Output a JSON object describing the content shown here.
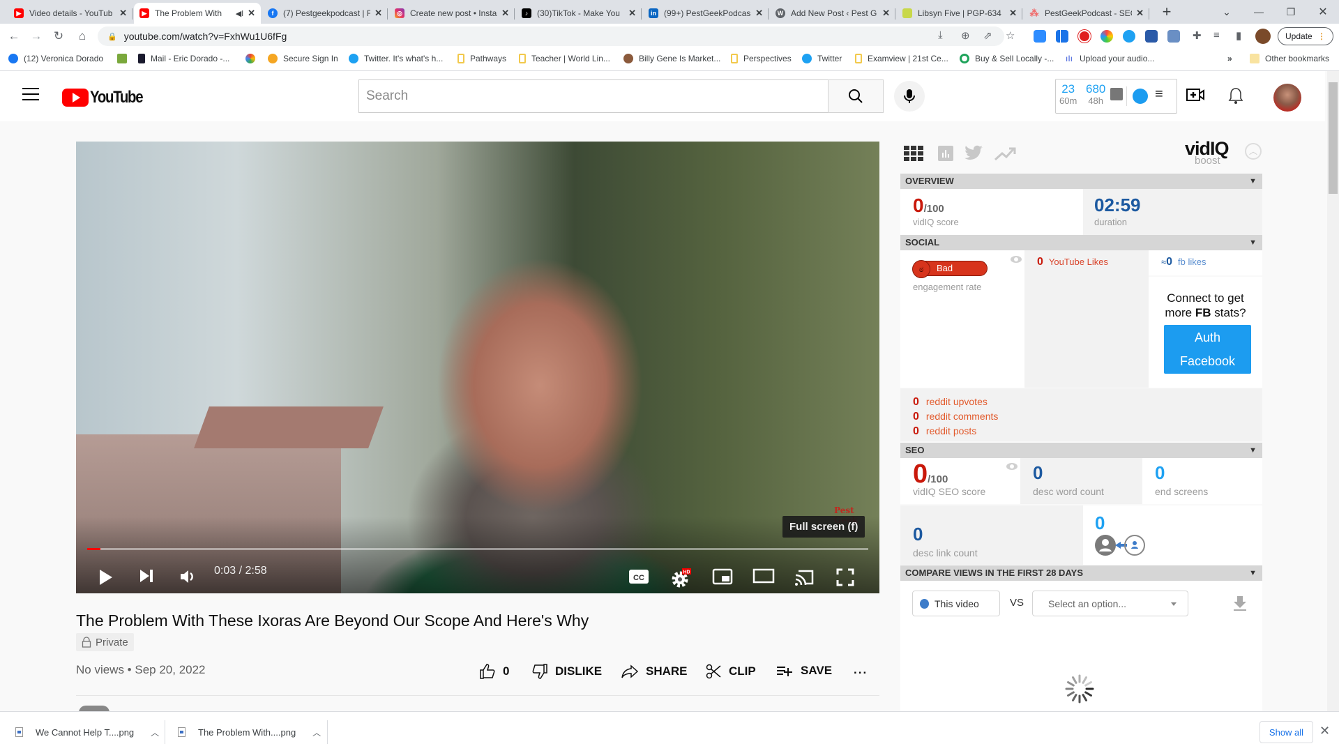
{
  "browser": {
    "tabs": [
      {
        "label": "Video details - YouTub",
        "icon": "youtube-icon",
        "color": "#ff0000",
        "active": false
      },
      {
        "label": "The Problem With",
        "icon": "youtube-icon",
        "color": "#ff0000",
        "active": true,
        "audio": true
      },
      {
        "label": "(7) Pestgeekpodcast | F",
        "icon": "facebook-icon",
        "color": "#1877f2",
        "active": false
      },
      {
        "label": "Create new post • Insta",
        "icon": "instagram-icon",
        "color": "#e1306c",
        "active": false
      },
      {
        "label": "(30)TikTok - Make You",
        "icon": "tiktok-icon",
        "color": "#000000",
        "active": false
      },
      {
        "label": "(99+) PestGeekPodcas",
        "icon": "linkedin-icon",
        "color": "#0a66c2",
        "active": false
      },
      {
        "label": "Add New Post ‹ Pest G",
        "icon": "wordpress-icon",
        "color": "#5f6368",
        "active": false
      },
      {
        "label": "Libsyn Five | PGP-634",
        "icon": "libsyn-icon",
        "color": "#a8c93a",
        "active": false
      },
      {
        "label": "PestGeekPodcast - SEO",
        "icon": "asana-icon",
        "color": "#f06a6a",
        "active": false
      }
    ],
    "url": "youtube.com/watch?v=FxhWu1U6fFg",
    "update_label": "Update",
    "bookmarks": [
      {
        "label": "(12) Veronica Dorado",
        "icon": "facebook-icon",
        "color": "#1877f2"
      },
      {
        "label": "",
        "icon": "game-icon",
        "color": "#7aa83c"
      },
      {
        "label": "Mail - Eric Dorado -...",
        "icon": "mail-icon",
        "color": "#1a1a2e"
      },
      {
        "label": "",
        "icon": "pinwheel-icon",
        "color": "#34a853"
      },
      {
        "label": "Secure Sign In",
        "icon": "sign-in-icon",
        "color": "#f5a623"
      },
      {
        "label": "Twitter. It's what's h...",
        "icon": "twitter-icon",
        "color": "#1da1f2"
      },
      {
        "label": "Pathways",
        "icon": "folder-icon",
        "color": "#f2c94c"
      },
      {
        "label": "Teacher | World Lin...",
        "icon": "folder-icon",
        "color": "#f2c94c"
      },
      {
        "label": "Billy Gene Is Market...",
        "icon": "person-icon",
        "color": "#8b5a3c"
      },
      {
        "label": "Perspectives",
        "icon": "folder-icon",
        "color": "#f2c94c"
      },
      {
        "label": "Twitter",
        "icon": "twitter-icon",
        "color": "#1da1f2"
      },
      {
        "label": "Examview | 21st Ce...",
        "icon": "folder-icon",
        "color": "#f2c94c"
      },
      {
        "label": "Buy & Sell Locally -...",
        "icon": "offerup-icon",
        "color": "#1fa35b"
      },
      {
        "label": "Upload your audio...",
        "icon": "audio-icon",
        "color": "#3b5bdb"
      }
    ],
    "more_bookmarks": "»",
    "other_bookmarks": "Other bookmarks"
  },
  "youtube": {
    "logo": "YouTube",
    "search_placeholder": "Search",
    "vidiq_header": {
      "stat1_value": "23",
      "stat1_label": "60m",
      "stat2_value": "680",
      "stat2_label": "48h"
    },
    "player": {
      "watermark": "Pest Geek",
      "tooltip": "Full screen (f)",
      "current_time": "0:03",
      "duration": "2:58",
      "time_readout": "0:03 / 2:58",
      "progress_fraction": 0.017,
      "hd_badge": "HD",
      "cc_label": "CC"
    },
    "video": {
      "title": "The Problem With These Ixoras Are Beyond Our Scope And Here's Why",
      "privacy": "Private",
      "views_date": "No views • Sep 20, 2022",
      "likes": "0",
      "dislike_label": "DISLIKE",
      "share_label": "SHARE",
      "clip_label": "CLIP",
      "save_label": "SAVE",
      "more_label": "..."
    }
  },
  "vidiq": {
    "brand": "vidIQ",
    "brand_sub": "boost",
    "overview": {
      "header": "OVERVIEW",
      "score": "0",
      "score_max": "/100",
      "score_label": "vidIQ score",
      "duration": "02:59",
      "duration_label": "duration"
    },
    "social": {
      "header": "SOCIAL",
      "engagement_badge": "Bad",
      "engagement_label": "engagement rate",
      "yt_likes": "0",
      "yt_likes_label": "YouTube Likes",
      "fb_likes_prefix": "≈",
      "fb_likes": "0",
      "fb_likes_label": "fb likes",
      "connect_text_1": "Connect to get",
      "connect_text_2a": "more ",
      "connect_text_2b": "FB",
      "connect_text_2c": " stats?",
      "auth_line1": "Auth",
      "auth_line2": "Facebook",
      "reddit": [
        {
          "value": "0",
          "label": "reddit upvotes"
        },
        {
          "value": "0",
          "label": "reddit comments"
        },
        {
          "value": "0",
          "label": "reddit posts"
        }
      ]
    },
    "seo": {
      "header": "SEO",
      "score": "0",
      "score_max": "/100",
      "score_label": "vidIQ SEO score",
      "desc_word_count": "0",
      "desc_word_count_label": "desc word count",
      "end_screens": "0",
      "end_screens_label": "end screens",
      "desc_link_count": "0",
      "desc_link_count_label": "desc link count",
      "subscribe_cards": "0"
    },
    "compare": {
      "header": "COMPARE VIEWS IN THE FIRST 28 DAYS",
      "this_video": "This video",
      "vs": "VS",
      "select_placeholder": "Select an option..."
    }
  },
  "downloads": {
    "items": [
      {
        "name": "We Cannot Help T....png"
      },
      {
        "name": "The Problem With....png"
      }
    ],
    "show_all": "Show all"
  }
}
